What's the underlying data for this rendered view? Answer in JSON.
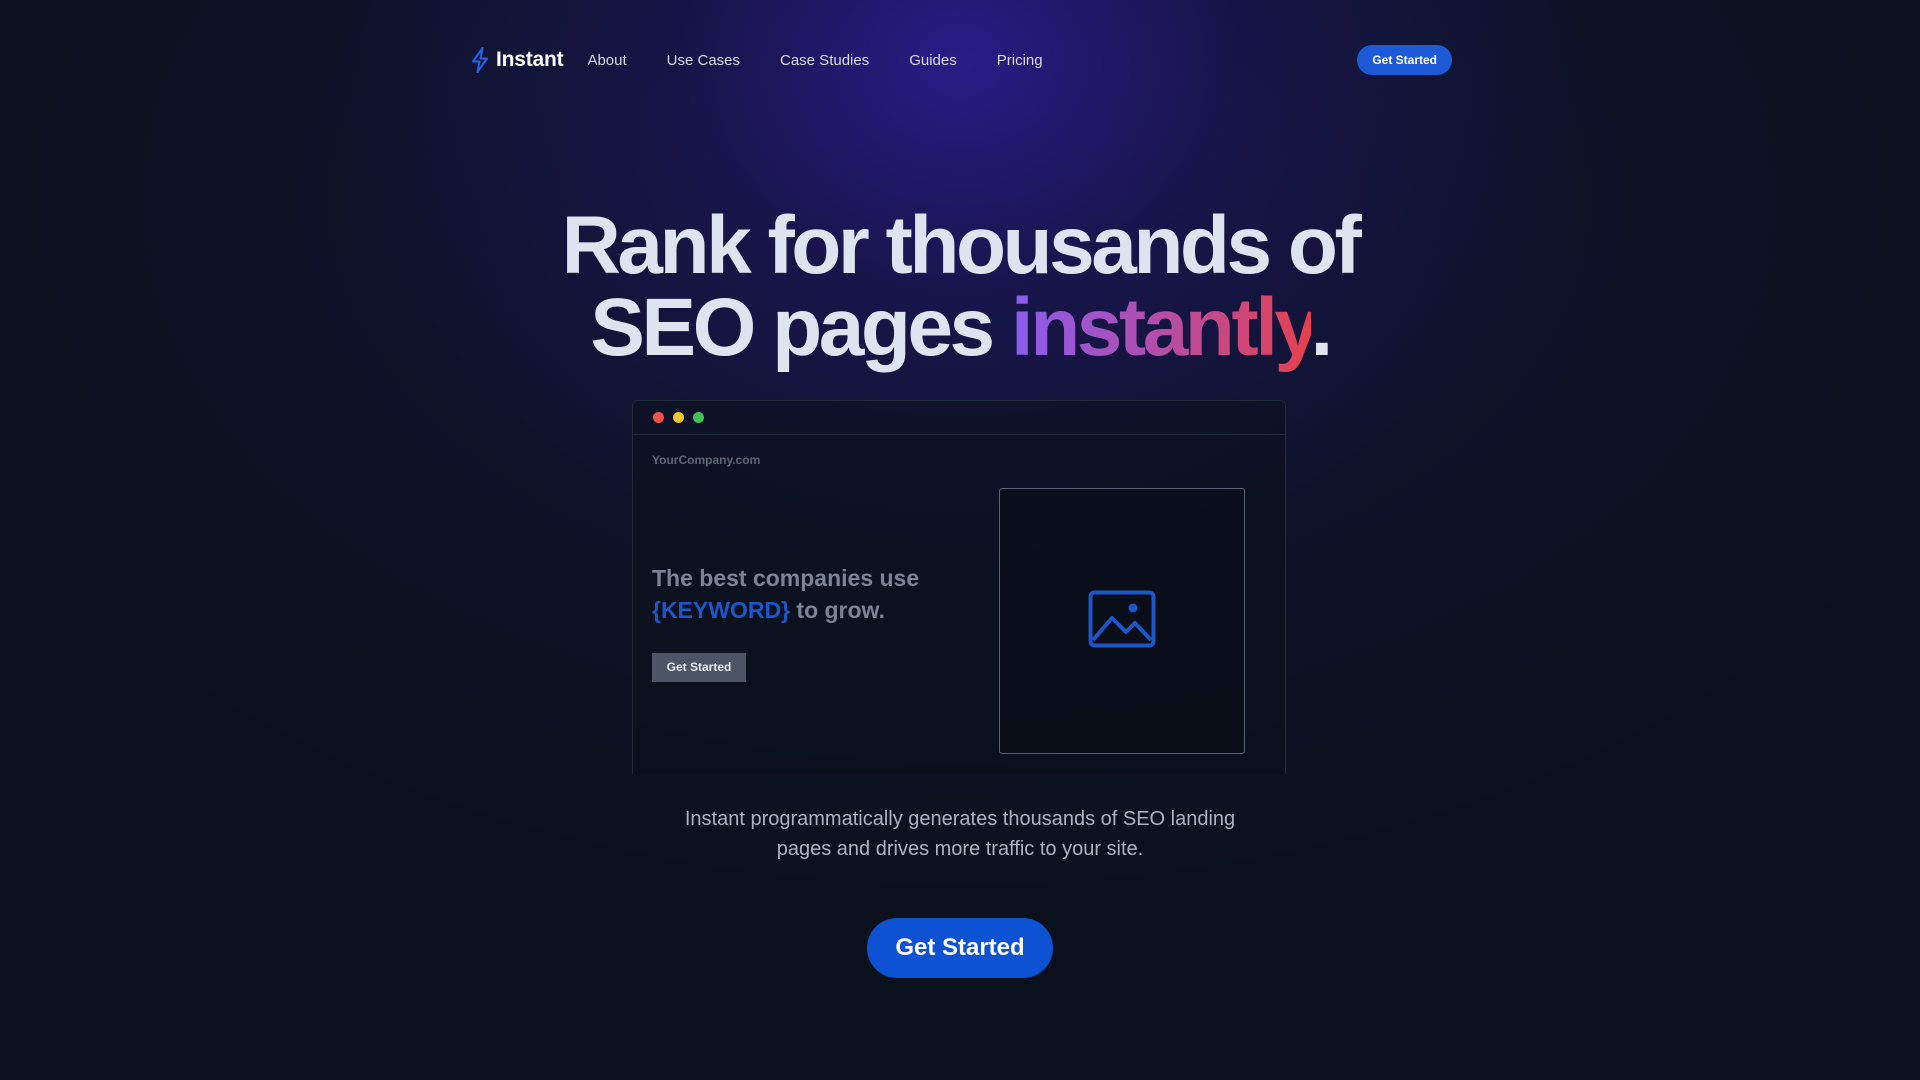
{
  "brand": {
    "name": "Instant",
    "icon": "lightning-bolt-icon",
    "accent_color": "#1c5ad8"
  },
  "nav": {
    "links": [
      "About",
      "Use Cases",
      "Case Studies",
      "Guides",
      "Pricing"
    ],
    "cta_label": "Get Started"
  },
  "hero": {
    "title_line1": "Rank for thousands of",
    "title_line2_prefix": "SEO pages ",
    "title_accent": "instantly",
    "title_suffix": ".",
    "description": "Instant programmatically generates thousands of SEO landing pages and drives more traffic to your site.",
    "cta_label": "Get Started"
  },
  "browser_mock": {
    "url": "YourCompany.com",
    "headline_prefix": "The best companies use ",
    "keyword": "{KEYWORD}",
    "headline_suffix": " to grow.",
    "button_label": "Get Started",
    "image_icon": "image-placeholder-icon",
    "window_dots": [
      "red",
      "yellow",
      "green"
    ]
  },
  "colors": {
    "background": "#0b111c",
    "primary_button": "#0d52d3",
    "keyword": "#1d56c8",
    "gradient_start": "#8a5cf0",
    "gradient_end": "#e6404f"
  }
}
